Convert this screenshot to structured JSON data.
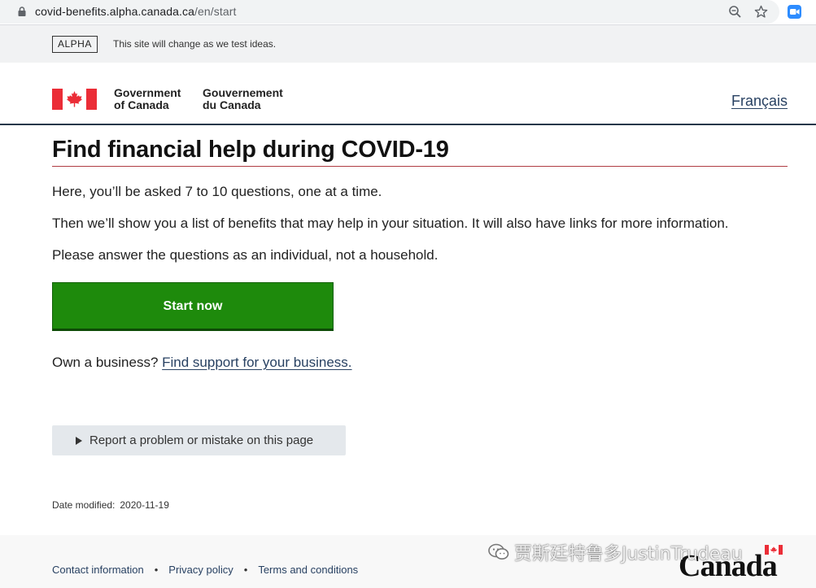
{
  "browser": {
    "url_host": "covid-benefits.alpha.canada.ca",
    "url_path": "/en/start",
    "icons": [
      "lock-icon",
      "zoom-icon",
      "star-icon",
      "extension-icon"
    ]
  },
  "alpha_banner": {
    "tag": "ALPHA",
    "text": "This site will change as we test ideas."
  },
  "header": {
    "wordmark_en_line1": "Government",
    "wordmark_en_line2": "of Canada",
    "wordmark_fr_line1": "Gouvernement",
    "wordmark_fr_line2": "du Canada",
    "language_link": "Français"
  },
  "main": {
    "title": "Find financial help during COVID-19",
    "paragraphs": [
      "Here, you’ll be asked 7 to 10 questions, one at a time.",
      "Then we’ll show you a list of benefits that may help in your situation. It will also have links for more information.",
      "Please answer the questions as an individual, not a household."
    ],
    "start_button": "Start now",
    "business_prompt": "Own a business?",
    "business_link": "Find support for your business.",
    "report_button": "Report a problem or mistake on this page",
    "date_label": "Date modified:",
    "date_value": "2020-11-19"
  },
  "footer": {
    "links": [
      "Contact information",
      "Privacy policy",
      "Terms and conditions"
    ],
    "separator": "•",
    "canada_wordmark": "Canada"
  },
  "watermark": {
    "text": "贾斯廷特鲁多JustinTrudeau"
  },
  "colors": {
    "start_button": "#1e8a0c",
    "link": "#284162",
    "title_rule": "#af3c43",
    "flag_red": "#eb2d37"
  }
}
